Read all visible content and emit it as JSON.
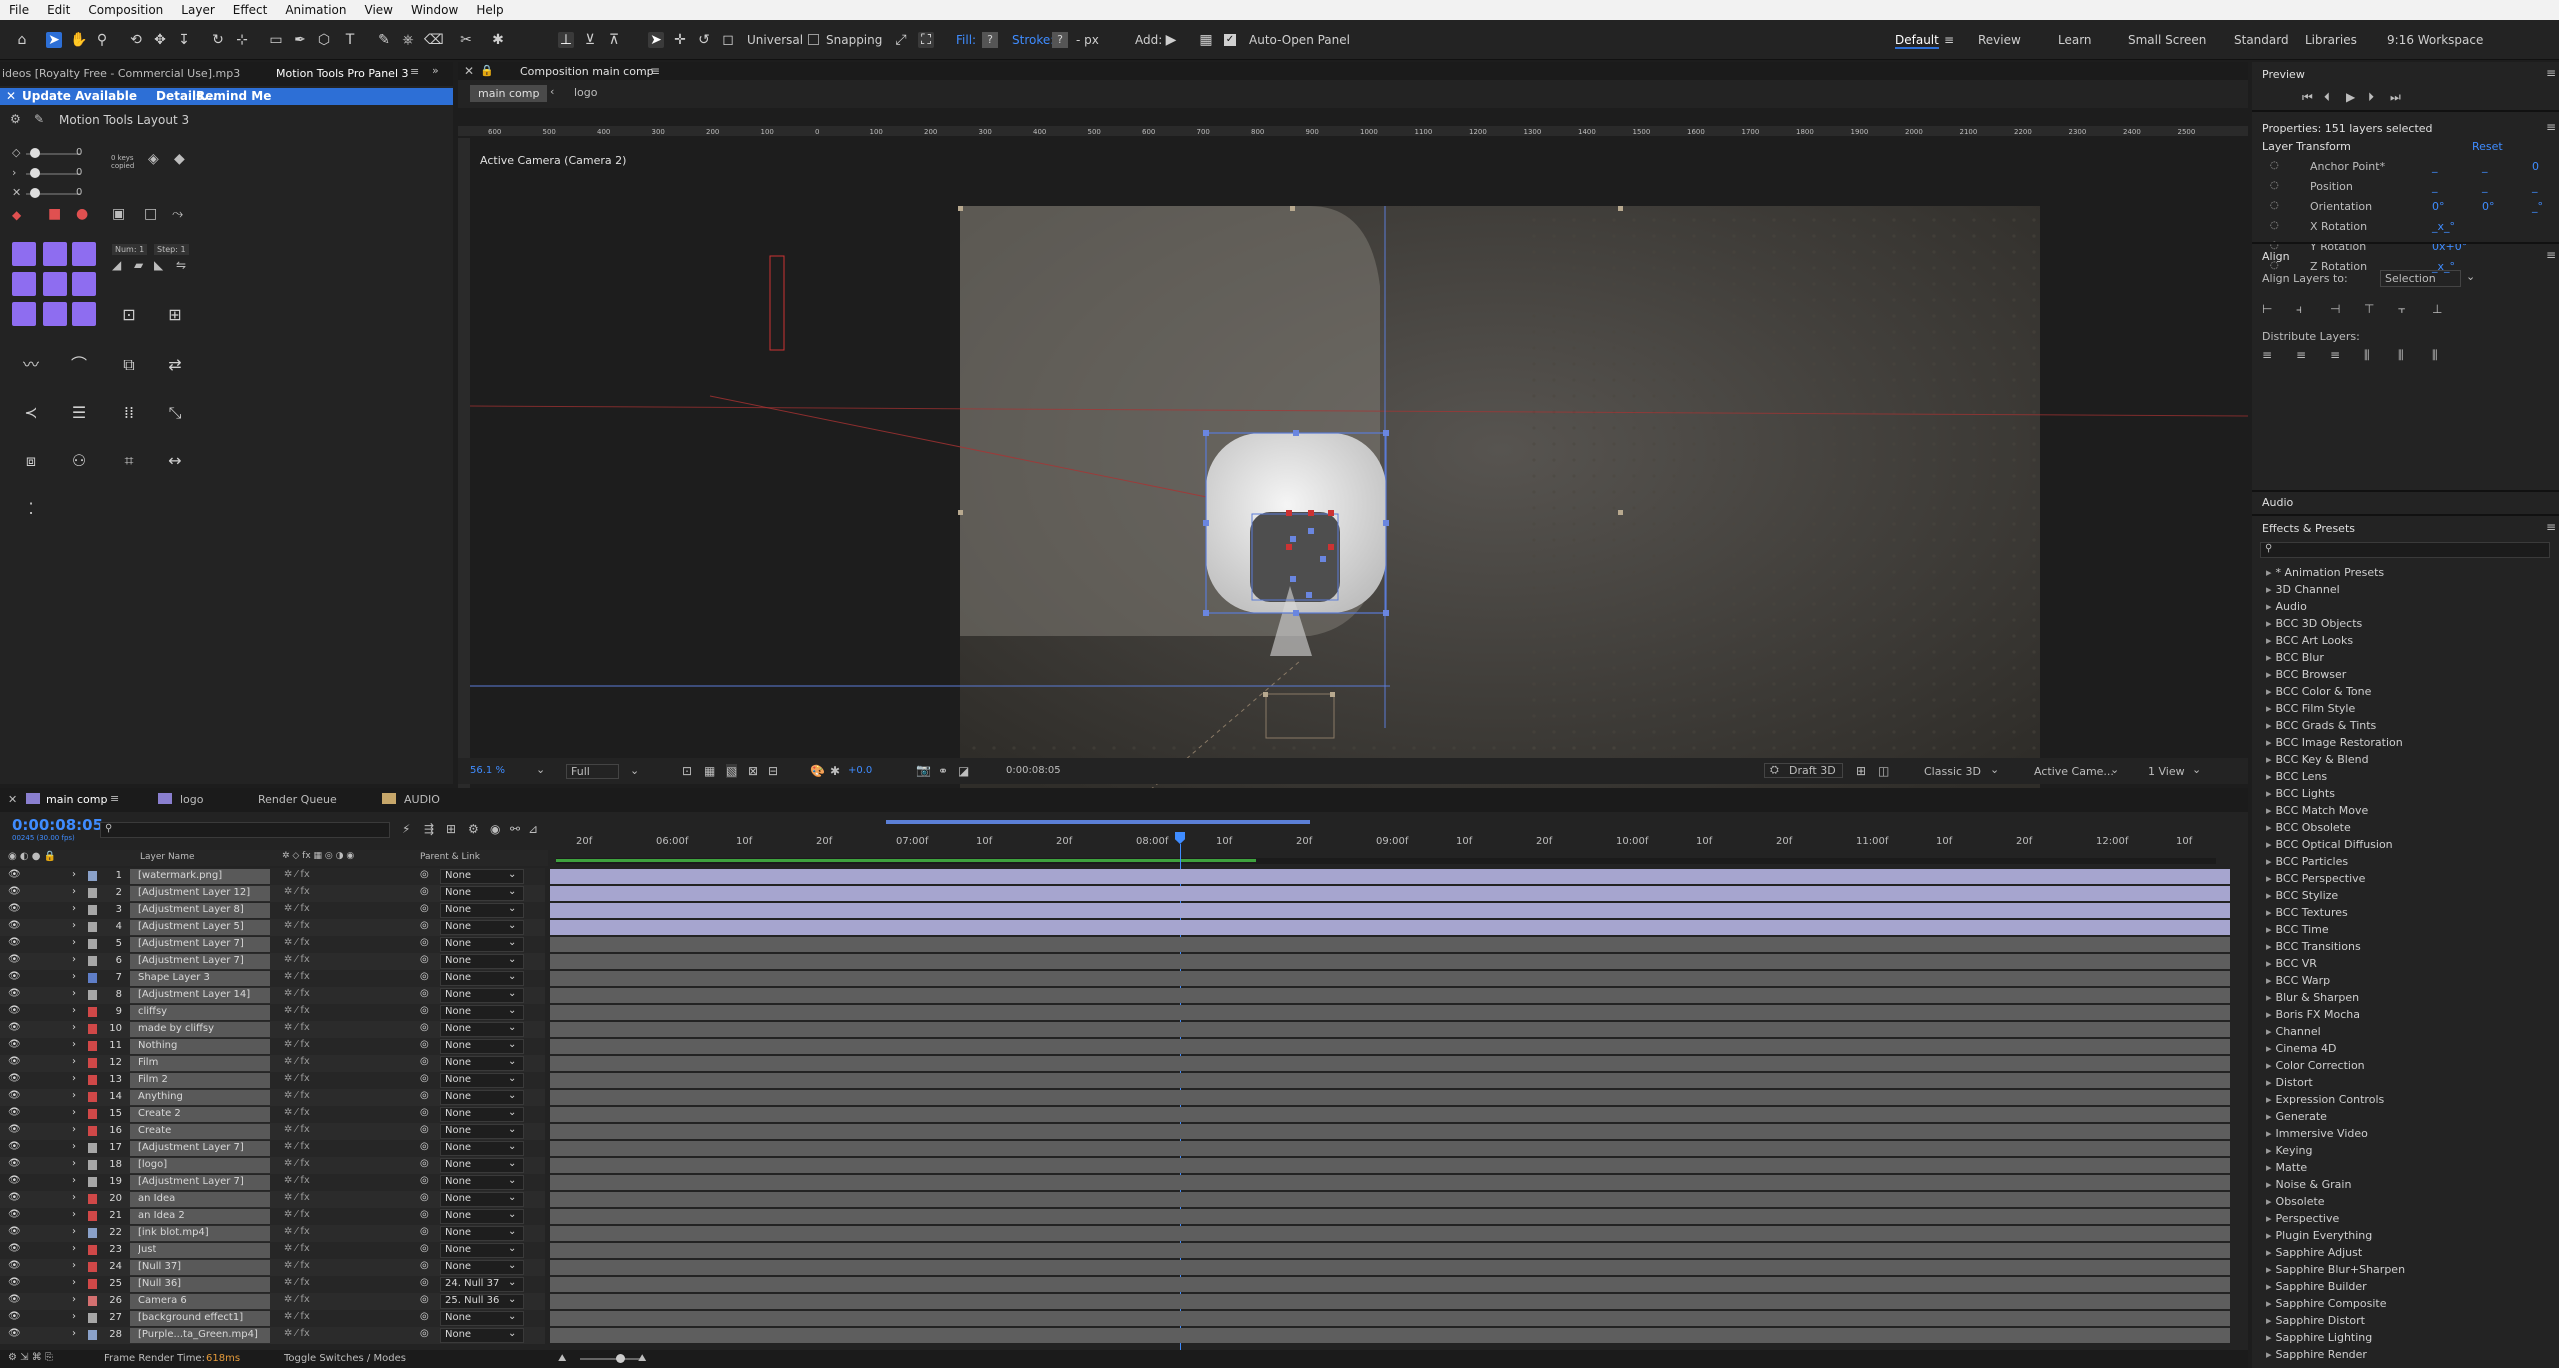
{
  "menu": [
    "File",
    "Edit",
    "Composition",
    "Layer",
    "Effect",
    "Animation",
    "View",
    "Window",
    "Help"
  ],
  "toolbar": {
    "universal": "Universal",
    "snapping": "Snapping",
    "fill": "Fill:",
    "stroke": "Stroke:",
    "stroke_unit": "- px",
    "add": "Add:",
    "auto_open": "Auto-Open Panel",
    "workspaces": [
      "Default",
      "Review",
      "Learn",
      "Small Screen",
      "Standard",
      "Libraries",
      "9:16 Workspace"
    ]
  },
  "left_panel": {
    "tab_file": "ideos [Royalty Free - Commercial Use].mp3",
    "tab_motion": "Motion Tools Pro Panel 3",
    "update": {
      "text": "Update Available",
      "details": "Details...",
      "remind": "Remind Me"
    },
    "layout_title": "Motion Tools Layout 3",
    "zero1": "0",
    "zero2": "0",
    "zero3": "0",
    "keys_copied": "0 keys copied",
    "num": "Num: 1",
    "step": "Step: 1"
  },
  "comp_viewer": {
    "tab_title": "Composition main comp",
    "breadcrumb_main": "main comp",
    "breadcrumb_logo": "logo",
    "camera_label": "Active Camera (Camera 2)",
    "ruler_labels": [
      "600",
      "500",
      "400",
      "300",
      "200",
      "100",
      "0",
      "100",
      "200",
      "300",
      "400",
      "500",
      "600",
      "700",
      "800",
      "900",
      "1000",
      "1100",
      "1200",
      "1300",
      "1400",
      "1500",
      "1600",
      "1700",
      "1800",
      "1900",
      "2000",
      "2100",
      "2200",
      "2300",
      "2400",
      "2500"
    ],
    "zoom": "56.1 %",
    "resolution": "Full",
    "exposure": "+0.0",
    "timecode": "0:00:08:05",
    "renderer": "Draft 3D",
    "renderer_mode": "Classic 3D",
    "camera_select": "Active Came...",
    "views": "1 View"
  },
  "right_panel": {
    "preview_title": "Preview",
    "properties_title": "Properties: 151 layers selected",
    "layer_transform": "Layer Transform",
    "reset": "Reset",
    "props": [
      {
        "name": "Anchor Point*",
        "v1": "_",
        "v2": "_",
        "v3": "0"
      },
      {
        "name": "Position",
        "v1": "_",
        "v2": "_",
        "v3": "_"
      },
      {
        "name": "Orientation",
        "v1": "0°",
        "v2": "0°",
        "v3": "_°"
      },
      {
        "name": "X Rotation",
        "v1": "_x_°",
        "v2": "",
        "v3": ""
      },
      {
        "name": "Y Rotation",
        "v1": "0x+0°",
        "v2": "",
        "v3": ""
      },
      {
        "name": "Z Rotation",
        "v1": "_x_°",
        "v2": "",
        "v3": ""
      }
    ],
    "align_title": "Align",
    "align_to_label": "Align Layers to:",
    "align_to_value": "Selection",
    "distribute_label": "Distribute Layers:",
    "audio_title": "Audio",
    "effects_title": "Effects & Presets",
    "effects": [
      "* Animation Presets",
      "3D Channel",
      "Audio",
      "BCC 3D Objects",
      "BCC Art Looks",
      "BCC Blur",
      "BCC Browser",
      "BCC Color & Tone",
      "BCC Film Style",
      "BCC Grads & Tints",
      "BCC Image Restoration",
      "BCC Key & Blend",
      "BCC Lens",
      "BCC Lights",
      "BCC Match Move",
      "BCC Obsolete",
      "BCC Optical Diffusion",
      "BCC Particles",
      "BCC Perspective",
      "BCC Stylize",
      "BCC Textures",
      "BCC Time",
      "BCC Transitions",
      "BCC VR",
      "BCC Warp",
      "Blur & Sharpen",
      "Boris FX Mocha",
      "Channel",
      "Cinema 4D",
      "Color Correction",
      "Distort",
      "Expression Controls",
      "Generate",
      "Immersive Video",
      "Keying",
      "Matte",
      "Noise & Grain",
      "Obsolete",
      "Perspective",
      "Plugin Everything",
      "Sapphire Adjust",
      "Sapphire Blur+Sharpen",
      "Sapphire Builder",
      "Sapphire Composite",
      "Sapphire Distort",
      "Sapphire Lighting",
      "Sapphire Render"
    ]
  },
  "timeline": {
    "tabs": [
      "main comp",
      "logo",
      "Render Queue",
      "AUDIO"
    ],
    "timecode": "0:00:08:05",
    "timecode_sub": "00245 (30.00 fps)",
    "col_layer_name": "Layer Name",
    "col_parent": "Parent & Link",
    "time_labels": [
      "20f",
      "06:00f",
      "10f",
      "20f",
      "07:00f",
      "10f",
      "20f",
      "08:00f",
      "10f",
      "20f",
      "09:00f",
      "10f",
      "20f",
      "10:00f",
      "10f",
      "20f",
      "11:00f",
      "10f",
      "20f",
      "12:00f",
      "10f"
    ],
    "layers": [
      {
        "num": "1",
        "name": "[watermark.png]",
        "color": "#8aa1c9",
        "parent": "None"
      },
      {
        "num": "2",
        "name": "[Adjustment Layer 12]",
        "color": "#a7a7a7",
        "parent": "None"
      },
      {
        "num": "3",
        "name": "[Adjustment Layer 8]",
        "color": "#a7a7a7",
        "parent": "None"
      },
      {
        "num": "4",
        "name": "[Adjustment Layer 5]",
        "color": "#a7a7a7",
        "parent": "None"
      },
      {
        "num": "5",
        "name": "[Adjustment Layer 7]",
        "color": "#a7a7a7",
        "parent": "None"
      },
      {
        "num": "6",
        "name": "[Adjustment Layer 7]",
        "color": "#a7a7a7",
        "parent": "None"
      },
      {
        "num": "7",
        "name": "Shape Layer 3",
        "color": "#5f7ec7",
        "parent": "None"
      },
      {
        "num": "8",
        "name": "[Adjustment Layer 14]",
        "color": "#a7a7a7",
        "parent": "None"
      },
      {
        "num": "9",
        "name": "cliffsy",
        "color": "#d04848",
        "parent": "None"
      },
      {
        "num": "10",
        "name": "made by cliffsy",
        "color": "#d04848",
        "parent": "None"
      },
      {
        "num": "11",
        "name": "Nothing",
        "color": "#d04848",
        "parent": "None"
      },
      {
        "num": "12",
        "name": "Film",
        "color": "#d04848",
        "parent": "None"
      },
      {
        "num": "13",
        "name": "Film 2",
        "color": "#d04848",
        "parent": "None"
      },
      {
        "num": "14",
        "name": "Anything",
        "color": "#d04848",
        "parent": "None"
      },
      {
        "num": "15",
        "name": "Create 2",
        "color": "#d04848",
        "parent": "None"
      },
      {
        "num": "16",
        "name": "Create",
        "color": "#d04848",
        "parent": "None"
      },
      {
        "num": "17",
        "name": "[Adjustment Layer 7]",
        "color": "#a7a7a7",
        "parent": "None"
      },
      {
        "num": "18",
        "name": "[logo]",
        "color": "#a7a7a7",
        "parent": "None"
      },
      {
        "num": "19",
        "name": "[Adjustment Layer 7]",
        "color": "#a7a7a7",
        "parent": "None"
      },
      {
        "num": "20",
        "name": "an Idea",
        "color": "#d04848",
        "parent": "None"
      },
      {
        "num": "21",
        "name": "an Idea 2",
        "color": "#d04848",
        "parent": "None"
      },
      {
        "num": "22",
        "name": "[ink blot.mp4]",
        "color": "#8aa1c9",
        "parent": "None"
      },
      {
        "num": "23",
        "name": "Just",
        "color": "#d04848",
        "parent": "None"
      },
      {
        "num": "24",
        "name": "[Null 37]",
        "color": "#d04848",
        "parent": "None"
      },
      {
        "num": "25",
        "name": "[Null 36]",
        "color": "#d04848",
        "parent": "24. Null 37"
      },
      {
        "num": "26",
        "name": "Camera 6",
        "color": "#d47070",
        "parent": "25. Null 36"
      },
      {
        "num": "27",
        "name": "[background effect1]",
        "color": "#a7a7a7",
        "parent": "None"
      },
      {
        "num": "28",
        "name": "[Purple...ta_Green.mp4]",
        "color": "#8aa1c9",
        "parent": "None"
      }
    ],
    "footer_render_label": "Frame Render Time:",
    "footer_render_value": "618ms",
    "footer_toggle": "Toggle Switches / Modes"
  },
  "colors": {
    "accent": "#2d6fd6",
    "update_bar": "#2d6fd6",
    "purple_btn": "#8e6df0",
    "track_lavender": "#a6a5cf",
    "track_gray": "#5e5e5e"
  }
}
